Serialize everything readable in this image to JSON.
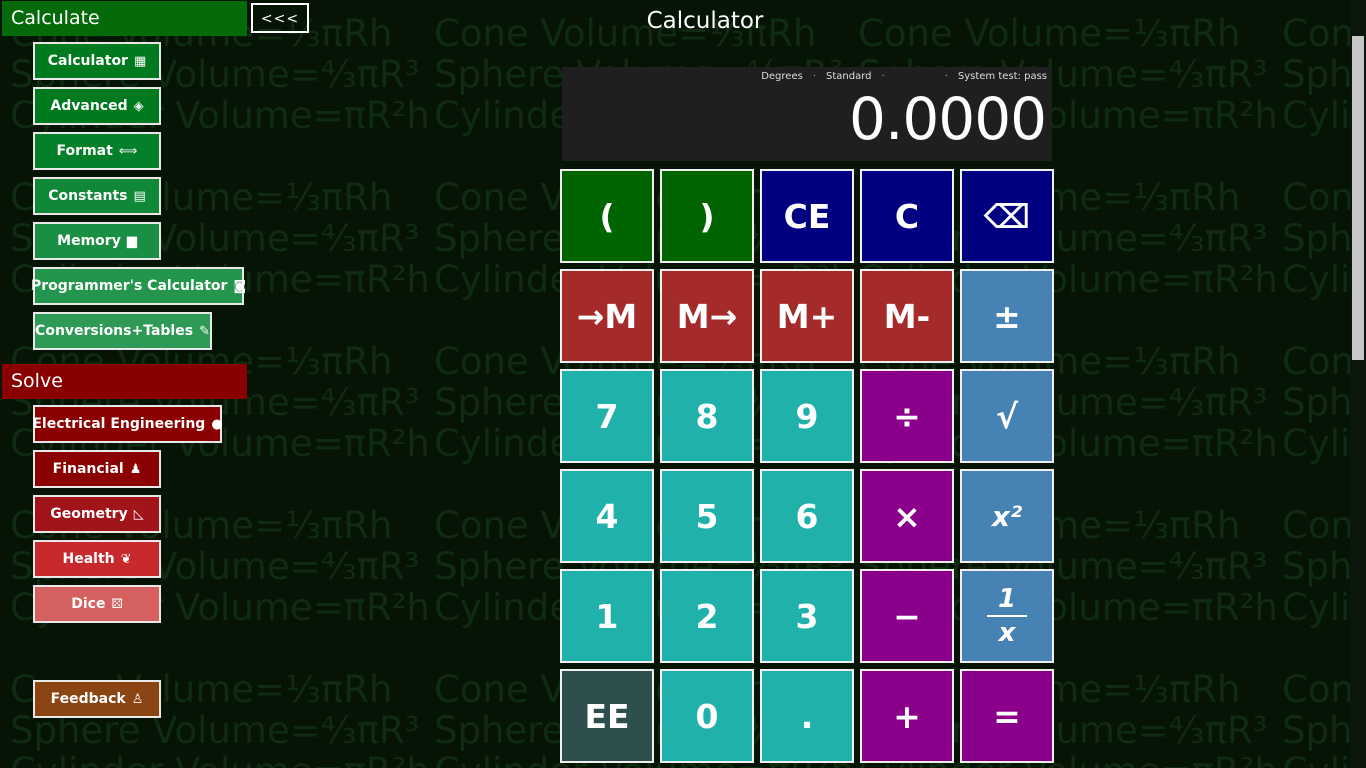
{
  "background_formulas": [
    "Cone Volume=⅓πRh",
    "Sphere Volume=⁴⁄₃πR³",
    "Cylinder Volume=πR²h"
  ],
  "nav": {
    "calculate_header": "Calculate",
    "collapse_label": "<<<",
    "calculate_items": [
      {
        "label": "Calculator",
        "icon": "calculator-icon",
        "glyph": "▦"
      },
      {
        "label": "Advanced",
        "icon": "graduation-cap-icon",
        "glyph": "◈"
      },
      {
        "label": "Format",
        "icon": "arrows-horizontal-icon",
        "glyph": "⟺"
      },
      {
        "label": "Constants",
        "icon": "list-icon",
        "glyph": "▤"
      },
      {
        "label": "Memory",
        "icon": "memory-icon",
        "glyph": "▆"
      },
      {
        "label": "Programmer's Calculator",
        "icon": "chip-icon",
        "glyph": "◙"
      },
      {
        "label": "Conversions+Tables",
        "icon": "pencil-icon",
        "glyph": "✎"
      }
    ],
    "solve_header": "Solve",
    "solve_items": [
      {
        "label": "Electrical Engineering",
        "icon": "lightbulb-icon",
        "glyph": "●"
      },
      {
        "label": "Financial",
        "icon": "money-bag-icon",
        "glyph": "♟"
      },
      {
        "label": "Geometry",
        "icon": "triangle-ruler-icon",
        "glyph": "◺"
      },
      {
        "label": "Health",
        "icon": "butterfly-icon",
        "glyph": "❦"
      },
      {
        "label": "Dice",
        "icon": "dice-icon",
        "glyph": "⚄"
      }
    ],
    "feedback": {
      "label": "Feedback",
      "icon": "feedback-icon",
      "glyph": "♙"
    }
  },
  "title": "Calculator",
  "display": {
    "angle_mode": "Degrees",
    "mode": "Standard",
    "system_test": "System test: pass",
    "value": "0.0000"
  },
  "keypad": {
    "rows": [
      [
        {
          "label": "(",
          "name": "open-paren-key",
          "color": "green"
        },
        {
          "label": ")",
          "name": "close-paren-key",
          "color": "green"
        },
        {
          "label": "CE",
          "name": "clear-entry-key",
          "color": "navy"
        },
        {
          "label": "C",
          "name": "clear-key",
          "color": "navy"
        },
        {
          "label": "⌫",
          "name": "backspace-key",
          "color": "navy"
        }
      ],
      [
        {
          "label": "→M",
          "name": "memory-store-key",
          "color": "red"
        },
        {
          "label": "M→",
          "name": "memory-recall-key",
          "color": "red"
        },
        {
          "label": "M+",
          "name": "memory-add-key",
          "color": "red"
        },
        {
          "label": "M-",
          "name": "memory-subtract-key",
          "color": "red"
        },
        {
          "label": "±",
          "name": "negate-key",
          "color": "steel"
        }
      ],
      [
        {
          "label": "7",
          "name": "digit-7-key",
          "color": "teal"
        },
        {
          "label": "8",
          "name": "digit-8-key",
          "color": "teal"
        },
        {
          "label": "9",
          "name": "digit-9-key",
          "color": "teal"
        },
        {
          "label": "÷",
          "name": "divide-key",
          "color": "purple"
        },
        {
          "label": "√",
          "name": "square-root-key",
          "color": "steel"
        }
      ],
      [
        {
          "label": "4",
          "name": "digit-4-key",
          "color": "teal"
        },
        {
          "label": "5",
          "name": "digit-5-key",
          "color": "teal"
        },
        {
          "label": "6",
          "name": "digit-6-key",
          "color": "teal"
        },
        {
          "label": "×",
          "name": "multiply-key",
          "color": "purple"
        },
        {
          "label": "x²",
          "name": "square-key",
          "color": "steel"
        }
      ],
      [
        {
          "label": "1",
          "name": "digit-1-key",
          "color": "teal"
        },
        {
          "label": "2",
          "name": "digit-2-key",
          "color": "teal"
        },
        {
          "label": "3",
          "name": "digit-3-key",
          "color": "teal"
        },
        {
          "label": "−",
          "name": "subtract-key",
          "color": "purple"
        },
        {
          "label": "1/x",
          "name": "reciprocal-key",
          "color": "steel"
        }
      ],
      [
        {
          "label": "EE",
          "name": "exponent-key",
          "color": "slate"
        },
        {
          "label": "0",
          "name": "digit-0-key",
          "color": "teal"
        },
        {
          "label": ".",
          "name": "decimal-key",
          "color": "teal"
        },
        {
          "label": "+",
          "name": "add-key",
          "color": "purple"
        },
        {
          "label": "=",
          "name": "equals-key",
          "color": "purple"
        }
      ]
    ]
  },
  "colors": {
    "background": "#051405",
    "calculate_green": "#056b0a",
    "solve_red": "#8a0000"
  }
}
